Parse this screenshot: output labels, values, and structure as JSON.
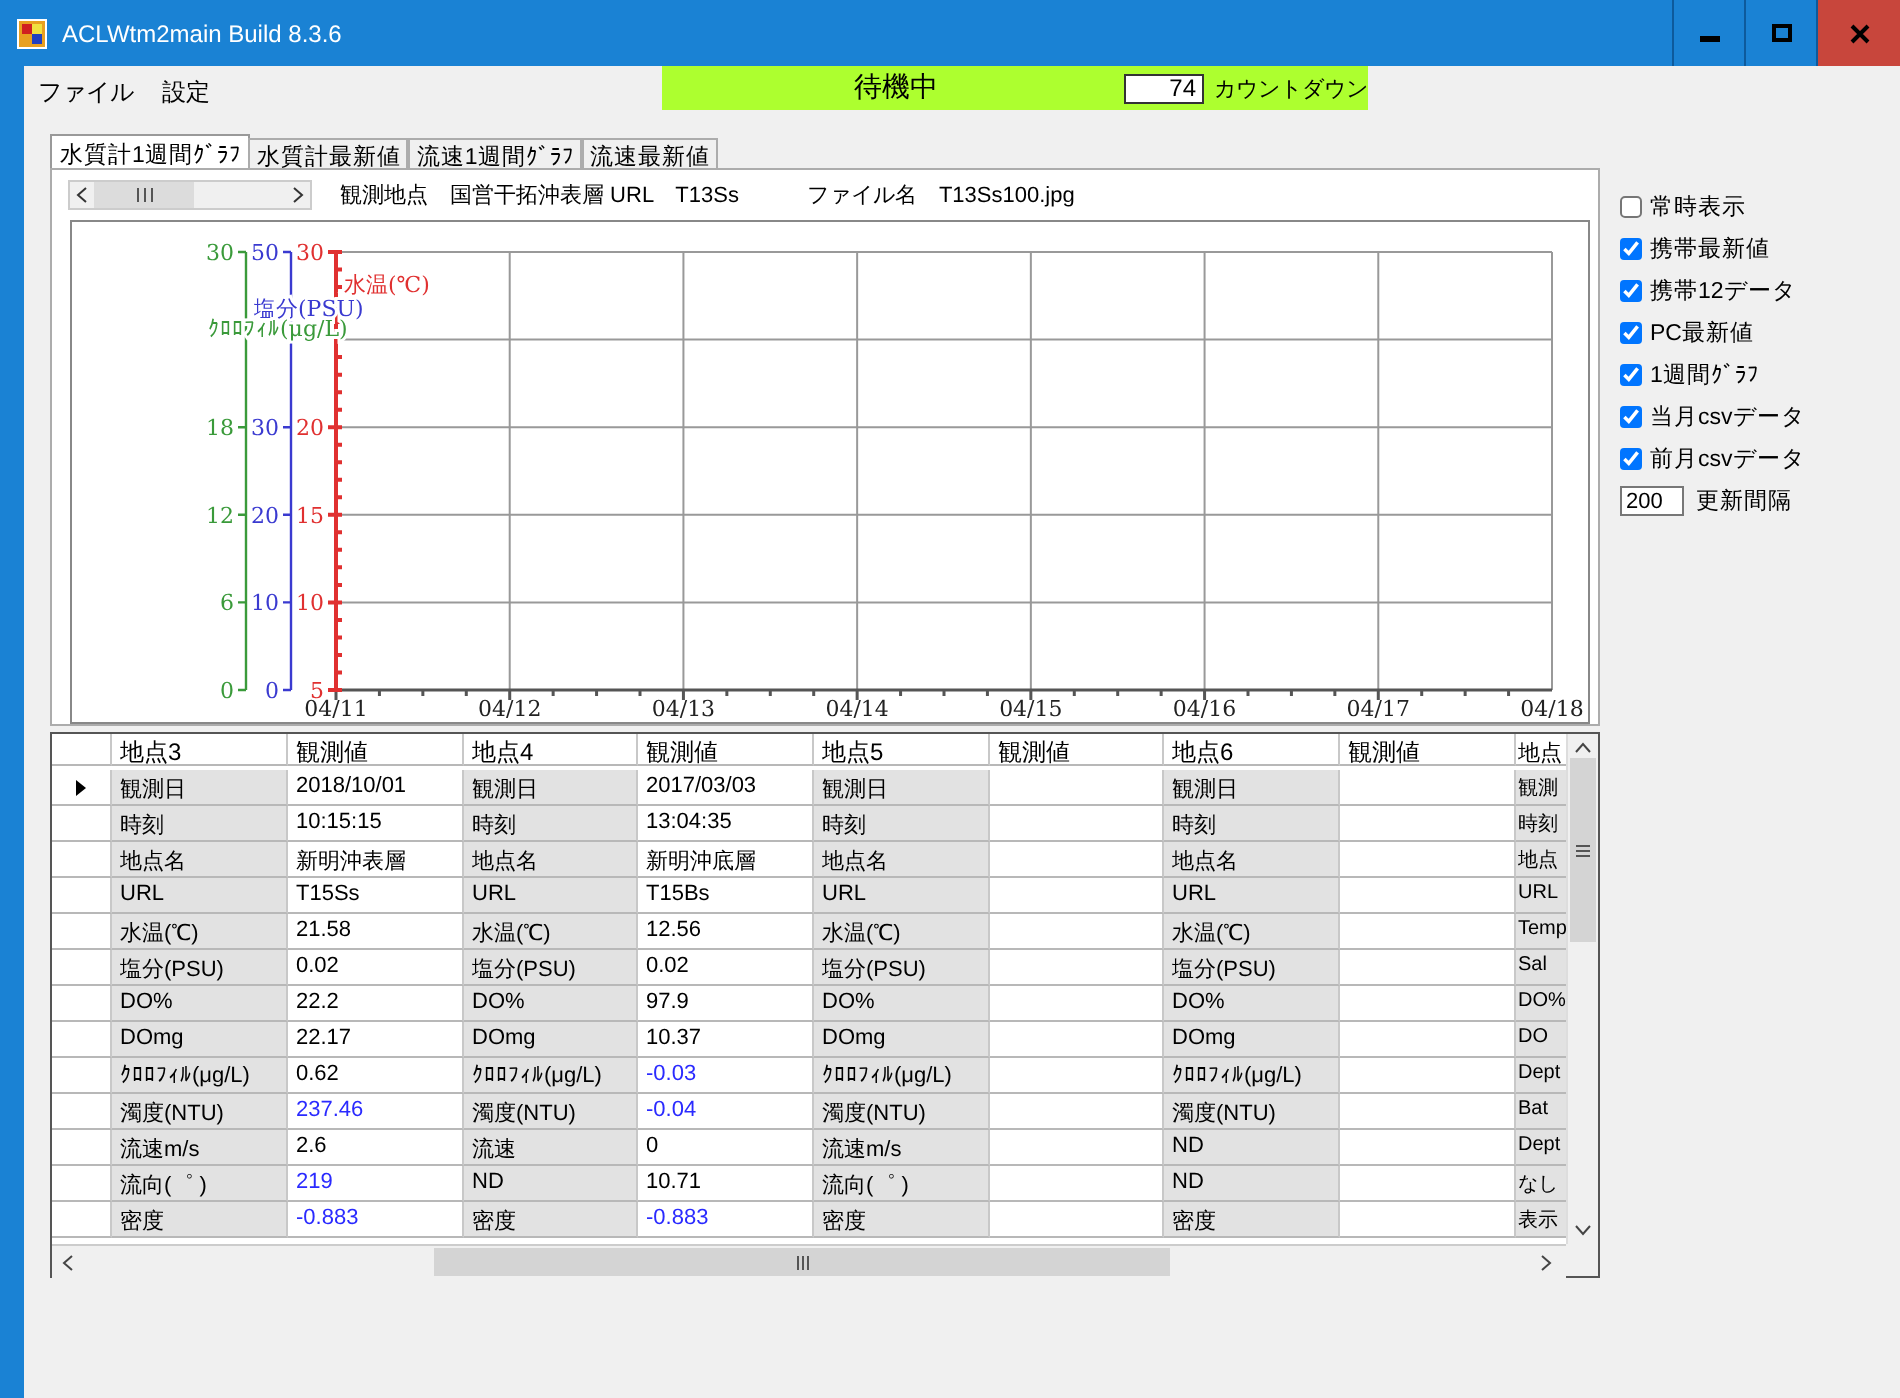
{
  "window": {
    "title": "ACLWtm2main  Build 8.3.6"
  },
  "menu": [
    {
      "label": "ファイル"
    },
    {
      "label": "設定"
    }
  ],
  "status": {
    "text": "待機中",
    "countdown": "74",
    "countdown_label": "カウントダウン"
  },
  "tabs": [
    {
      "label": "水質計1週間ｸﾞﾗﾌ",
      "selected": true
    },
    {
      "label": "水質計最新値",
      "selected": false
    },
    {
      "label": "流速1週間ｸﾞﾗﾌ",
      "selected": false
    },
    {
      "label": "流速最新値",
      "selected": false
    }
  ],
  "location_bar": {
    "text": "観測地点　国営干拓沖表層 URL　T13Ss",
    "file_text": "ファイル名　T13Ss100.jpg"
  },
  "chart": {
    "axes": [
      {
        "label": "水温(℃)",
        "color": "#e03030"
      },
      {
        "label": "塩分(PSU)",
        "color": "#3a3ad0",
        "ticks": [
          "50",
          "30",
          "20",
          "10",
          "0"
        ]
      },
      {
        "label": "ｸﾛﾛﾌｨﾙ(μg/L)",
        "color": "#3a9a3a",
        "ticks": [
          "30",
          "18",
          "12",
          "6",
          "0"
        ]
      }
    ],
    "chart_data": {
      "type": "line",
      "grid": true,
      "categories": [
        "04/11",
        "04/12",
        "04/13",
        "04/14",
        "04/15",
        "04/16",
        "04/17",
        "04/18"
      ],
      "ylim": [
        5,
        30
      ],
      "yticks": [
        5,
        10,
        15,
        20,
        30
      ]
    }
  },
  "table": {
    "columns": [
      "地点3",
      "観測値",
      "地点4",
      "観測値",
      "地点5",
      "観測値",
      "地点6",
      "観測値",
      "地点"
    ],
    "rows": [
      {
        "current": true,
        "cells": [
          {
            "kind": "label",
            "text": "観測日"
          },
          {
            "kind": "value",
            "text": "2018/10/01",
            "highlighted": false
          },
          {
            "kind": "label",
            "text": "観測日"
          },
          {
            "kind": "value",
            "text": "2017/03/03",
            "highlighted": false
          },
          {
            "kind": "label",
            "text": "観測日"
          },
          {
            "kind": "value"
          },
          {
            "kind": "label",
            "text": "観測日"
          },
          {
            "kind": "value"
          },
          {
            "kind": "label",
            "text": "観測"
          }
        ]
      },
      {
        "current": false,
        "cells": [
          {
            "kind": "label",
            "text": "時刻"
          },
          {
            "kind": "value",
            "text": "10:15:15",
            "highlighted": false
          },
          {
            "kind": "label",
            "text": "時刻"
          },
          {
            "kind": "value",
            "text": "13:04:35",
            "highlighted": false
          },
          {
            "kind": "label",
            "text": "時刻"
          },
          {
            "kind": "value"
          },
          {
            "kind": "label",
            "text": "時刻"
          },
          {
            "kind": "value"
          },
          {
            "kind": "label",
            "text": "時刻"
          }
        ]
      },
      {
        "current": false,
        "cells": [
          {
            "kind": "label",
            "text": "地点名"
          },
          {
            "kind": "value",
            "text": "新明沖表層",
            "highlighted": false
          },
          {
            "kind": "label",
            "text": "地点名"
          },
          {
            "kind": "value",
            "text": "新明沖底層",
            "highlighted": false
          },
          {
            "kind": "label",
            "text": "地点名"
          },
          {
            "kind": "value"
          },
          {
            "kind": "label",
            "text": "地点名"
          },
          {
            "kind": "value"
          },
          {
            "kind": "label",
            "text": "地点"
          }
        ]
      },
      {
        "current": false,
        "cells": [
          {
            "kind": "label",
            "text": "URL"
          },
          {
            "kind": "value",
            "text": "T15Ss",
            "highlighted": false
          },
          {
            "kind": "label",
            "text": "URL"
          },
          {
            "kind": "value",
            "text": "T15Bs",
            "highlighted": false
          },
          {
            "kind": "label",
            "text": "URL"
          },
          {
            "kind": "value"
          },
          {
            "kind": "label",
            "text": "URL"
          },
          {
            "kind": "value"
          },
          {
            "kind": "label",
            "text": "URL"
          }
        ]
      },
      {
        "current": false,
        "cells": [
          {
            "kind": "label",
            "text": "水温(℃)"
          },
          {
            "kind": "value",
            "text": "21.58",
            "highlighted": false
          },
          {
            "kind": "label",
            "text": "水温(℃)"
          },
          {
            "kind": "value",
            "text": "12.56",
            "highlighted": false
          },
          {
            "kind": "label",
            "text": "水温(℃)"
          },
          {
            "kind": "value"
          },
          {
            "kind": "label",
            "text": "水温(℃)"
          },
          {
            "kind": "value"
          },
          {
            "kind": "label",
            "text": "Temp"
          }
        ]
      },
      {
        "current": false,
        "cells": [
          {
            "kind": "label",
            "text": "塩分(PSU)"
          },
          {
            "kind": "value",
            "text": "0.02",
            "highlighted": false
          },
          {
            "kind": "label",
            "text": "塩分(PSU)"
          },
          {
            "kind": "value",
            "text": "0.02",
            "highlighted": false
          },
          {
            "kind": "label",
            "text": "塩分(PSU)"
          },
          {
            "kind": "value"
          },
          {
            "kind": "label",
            "text": "塩分(PSU)"
          },
          {
            "kind": "value"
          },
          {
            "kind": "label",
            "text": "Sal"
          }
        ]
      },
      {
        "current": false,
        "cells": [
          {
            "kind": "label",
            "text": "DO%"
          },
          {
            "kind": "value",
            "text": "22.2",
            "highlighted": false
          },
          {
            "kind": "label",
            "text": "DO%"
          },
          {
            "kind": "value",
            "text": "97.9",
            "highlighted": false
          },
          {
            "kind": "label",
            "text": "DO%"
          },
          {
            "kind": "value"
          },
          {
            "kind": "label",
            "text": "DO%"
          },
          {
            "kind": "value"
          },
          {
            "kind": "label",
            "text": "DO%"
          }
        ]
      },
      {
        "current": false,
        "cells": [
          {
            "kind": "label",
            "text": "DOmg"
          },
          {
            "kind": "value",
            "text": "22.17",
            "highlighted": false
          },
          {
            "kind": "label",
            "text": "DOmg"
          },
          {
            "kind": "value",
            "text": "10.37",
            "highlighted": false
          },
          {
            "kind": "label",
            "text": "DOmg"
          },
          {
            "kind": "value"
          },
          {
            "kind": "label",
            "text": "DOmg"
          },
          {
            "kind": "value"
          },
          {
            "kind": "label",
            "text": "DO"
          }
        ]
      },
      {
        "current": false,
        "cells": [
          {
            "kind": "label",
            "text": "ｸﾛﾛﾌｨﾙ(μg/L)"
          },
          {
            "kind": "value",
            "text": "0.62",
            "highlighted": false
          },
          {
            "kind": "label",
            "text": "ｸﾛﾛﾌｨﾙ(μg/L)"
          },
          {
            "kind": "value",
            "text": "-0.03",
            "highlighted": true
          },
          {
            "kind": "label",
            "text": "ｸﾛﾛﾌｨﾙ(μg/L)"
          },
          {
            "kind": "value"
          },
          {
            "kind": "label",
            "text": "ｸﾛﾛﾌｨﾙ(μg/L)"
          },
          {
            "kind": "value"
          },
          {
            "kind": "label",
            "text": "Dept"
          }
        ]
      },
      {
        "current": false,
        "cells": [
          {
            "kind": "label",
            "text": "濁度(NTU)"
          },
          {
            "kind": "value",
            "text": "237.46",
            "highlighted": true
          },
          {
            "kind": "label",
            "text": "濁度(NTU)"
          },
          {
            "kind": "value",
            "text": "-0.04",
            "highlighted": true
          },
          {
            "kind": "label",
            "text": "濁度(NTU)"
          },
          {
            "kind": "value"
          },
          {
            "kind": "label",
            "text": "濁度(NTU)"
          },
          {
            "kind": "value"
          },
          {
            "kind": "label",
            "text": "Bat"
          }
        ]
      },
      {
        "current": false,
        "cells": [
          {
            "kind": "label",
            "text": "流速m/s"
          },
          {
            "kind": "value",
            "text": "2.6",
            "highlighted": false
          },
          {
            "kind": "label",
            "text": "流速"
          },
          {
            "kind": "value",
            "text": "0",
            "highlighted": false
          },
          {
            "kind": "label",
            "text": "流速m/s"
          },
          {
            "kind": "value"
          },
          {
            "kind": "label",
            "text": "ND"
          },
          {
            "kind": "value"
          },
          {
            "kind": "label",
            "text": "Dept"
          }
        ]
      },
      {
        "current": false,
        "cells": [
          {
            "kind": "label",
            "text": "流向(゜ )"
          },
          {
            "kind": "value",
            "text": "219",
            "highlighted": true
          },
          {
            "kind": "label",
            "text": "ND"
          },
          {
            "kind": "value",
            "text": "10.71",
            "highlighted": false
          },
          {
            "kind": "label",
            "text": "流向(゜ )"
          },
          {
            "kind": "value"
          },
          {
            "kind": "label",
            "text": "ND"
          },
          {
            "kind": "value"
          },
          {
            "kind": "label",
            "text": "なし"
          }
        ]
      },
      {
        "current": false,
        "cells": [
          {
            "kind": "label",
            "text": "密度"
          },
          {
            "kind": "value",
            "text": "-0.883",
            "highlighted": true
          },
          {
            "kind": "label",
            "text": "密度"
          },
          {
            "kind": "value",
            "text": "-0.883",
            "highlighted": true
          },
          {
            "kind": "label",
            "text": "密度"
          },
          {
            "kind": "value"
          },
          {
            "kind": "label",
            "text": "密度"
          },
          {
            "kind": "value"
          },
          {
            "kind": "label",
            "text": "表示"
          }
        ]
      }
    ]
  },
  "options": [
    {
      "label": "常時表示",
      "checked": false
    },
    {
      "label": "携帯最新値",
      "checked": true
    },
    {
      "label": "携帯12データ",
      "checked": true
    },
    {
      "label": "PC最新値",
      "checked": true
    },
    {
      "label": "1週間ｸﾞﾗﾌ",
      "checked": true
    },
    {
      "label": "当月csvデータ",
      "checked": true
    },
    {
      "label": "前月csvデータ",
      "checked": true
    }
  ],
  "interval": {
    "value": "200",
    "label": "更新間隔"
  }
}
